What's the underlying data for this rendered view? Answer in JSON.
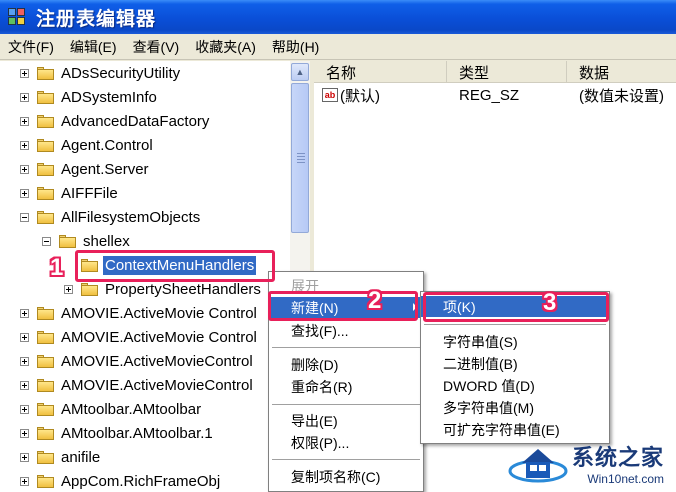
{
  "window": {
    "title": "注册表编辑器"
  },
  "menubar": [
    "文件(F)",
    "编辑(E)",
    "查看(V)",
    "收藏夹(A)",
    "帮助(H)"
  ],
  "tree": {
    "items": [
      {
        "label": "ADsSecurityUtility",
        "expander": "plus"
      },
      {
        "label": "ADSystemInfo",
        "expander": "plus"
      },
      {
        "label": "AdvancedDataFactory",
        "expander": "plus"
      },
      {
        "label": "Agent.Control",
        "expander": "plus"
      },
      {
        "label": "Agent.Server",
        "expander": "plus"
      },
      {
        "label": "AIFFFile",
        "expander": "plus"
      },
      {
        "label": "AllFilesystemObjects",
        "expander": "minus"
      },
      {
        "label": "shellex",
        "expander": "minus"
      },
      {
        "label": "ContextMenuHandlers",
        "expander": "none",
        "selected": true
      },
      {
        "label": "PropertySheetHandlers",
        "expander": "plus"
      },
      {
        "label": "AMOVIE.ActiveMovie Control",
        "expander": "plus"
      },
      {
        "label": "AMOVIE.ActiveMovie Control",
        "expander": "plus"
      },
      {
        "label": "AMOVIE.ActiveMovieControl",
        "expander": "plus"
      },
      {
        "label": "AMOVIE.ActiveMovieControl",
        "expander": "plus"
      },
      {
        "label": "AMtoolbar.AMtoolbar",
        "expander": "plus"
      },
      {
        "label": "AMtoolbar.AMtoolbar.1",
        "expander": "plus"
      },
      {
        "label": "anifile",
        "expander": "plus"
      },
      {
        "label": "AppCom.RichFrameObj",
        "expander": "plus"
      }
    ]
  },
  "list": {
    "columns": [
      "名称",
      "类型",
      "数据"
    ],
    "rows": [
      {
        "name": "(默认)",
        "type": "REG_SZ",
        "data": "(数值未设置)"
      }
    ]
  },
  "context_menu": {
    "items": [
      "展开",
      "新建(N)",
      "查找(F)...",
      "删除(D)",
      "重命名(R)",
      "导出(E)",
      "权限(P)...",
      "复制项名称(C)"
    ]
  },
  "submenu": {
    "items": [
      "项(K)",
      "字符串值(S)",
      "二进制值(B)",
      "DWORD 值(D)",
      "多字符串值(M)",
      "可扩充字符串值(E)"
    ]
  },
  "markers": [
    "1",
    "2",
    "3"
  ],
  "watermark": {
    "cn": "系统之家",
    "en": "Win10net.com"
  },
  "colors": {
    "highlight": "#316ac5",
    "annotation": "#e8205a",
    "titlebar": "#0a4fd8"
  }
}
